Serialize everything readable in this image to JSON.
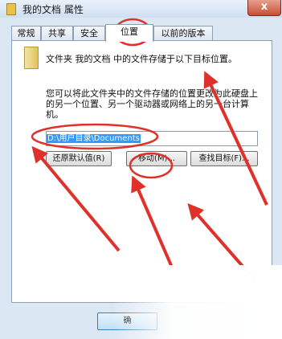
{
  "window": {
    "title": "我的文档 属性",
    "close_label": "x"
  },
  "tabs": [
    {
      "label": "常规"
    },
    {
      "label": "共享"
    },
    {
      "label": "安全"
    },
    {
      "label": "位置",
      "active": true
    },
    {
      "label": "以前的版本"
    }
  ],
  "location": {
    "description": "文件夹 我的文档 中的文件存储于以下目标位置。",
    "detail": "您可以将此文件夹中的文件存储的位置更改为此硬盘上的另一个位置、另一个驱动器或网络上的另一台计算机。",
    "path_value": "D:\\用户目录\\Documents"
  },
  "buttons": {
    "restore_default": "还原默认值(R)",
    "move": "移动(M)...",
    "find_target": "查找目标(F)..."
  },
  "footer": {
    "ok_partial": "确"
  },
  "annotations": {
    "color": "#e0302a"
  }
}
